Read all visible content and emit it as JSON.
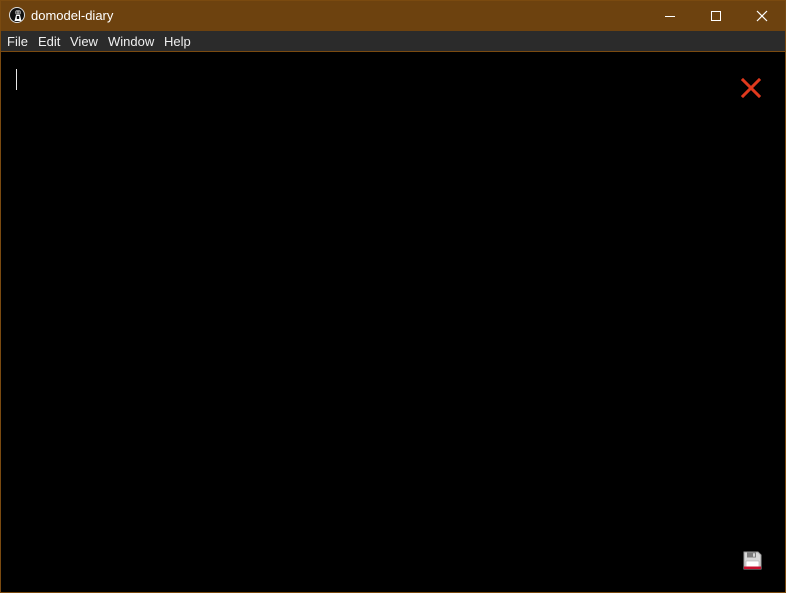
{
  "window": {
    "title": "domodel-diary",
    "title_bar_color": "#6d420f",
    "app_icon": "diary-app-icon",
    "controls": [
      "minimize-icon",
      "maximize-icon",
      "close-icon"
    ]
  },
  "menu": {
    "items": [
      {
        "label": "File"
      },
      {
        "label": "Edit"
      },
      {
        "label": "View"
      },
      {
        "label": "Window"
      },
      {
        "label": "Help"
      }
    ]
  },
  "editor": {
    "content": "",
    "background": "#000000",
    "close_icon": "red-x-close-icon",
    "close_color": "#e0391d",
    "save_icon": "floppy-disk-save-icon"
  }
}
